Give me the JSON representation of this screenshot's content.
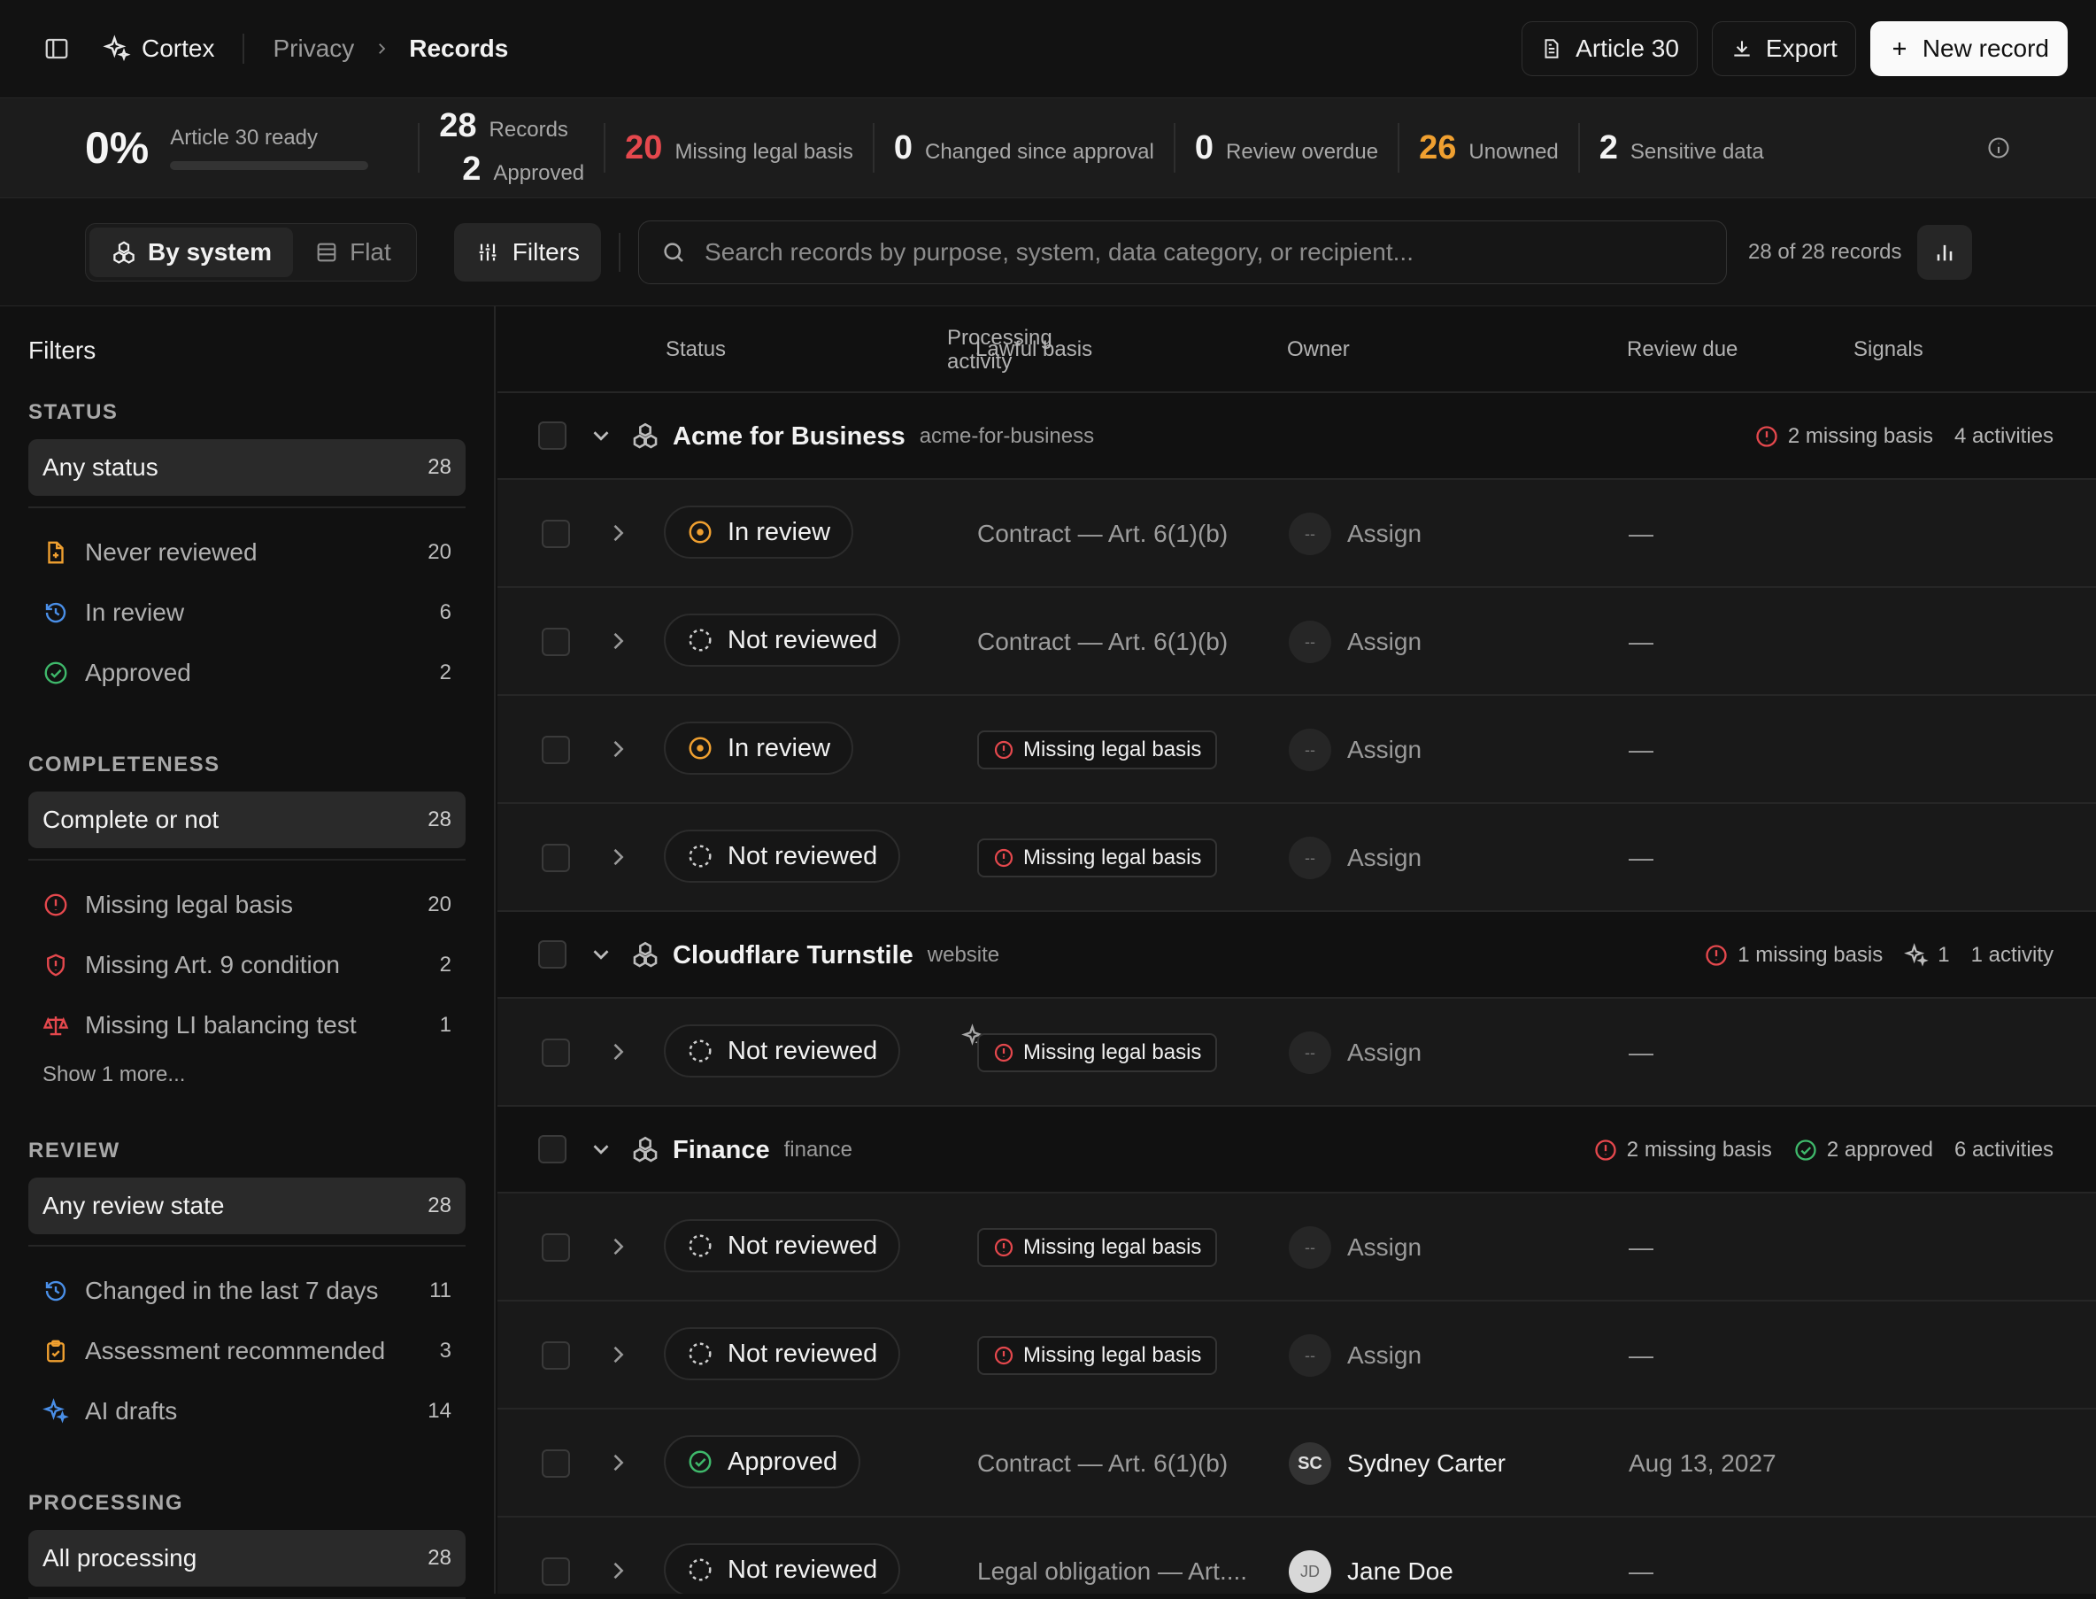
{
  "app": {
    "name": "Cortex",
    "breadcrumb": [
      "Privacy",
      "Records"
    ]
  },
  "header_buttons": {
    "article30": "Article 30",
    "export": "Export",
    "new_record": "New record"
  },
  "stats": {
    "percent": "0%",
    "percent_label": "Article 30 ready",
    "readiness_fraction": 0,
    "records": {
      "value": "28",
      "label": "Records"
    },
    "approved": {
      "value": "2",
      "label": "Approved"
    },
    "missing": {
      "value": "20",
      "label": "Missing legal basis"
    },
    "changed": {
      "value": "0",
      "label": "Changed since approval"
    },
    "overdue": {
      "value": "0",
      "label": "Review overdue"
    },
    "unowned": {
      "value": "26",
      "label": "Unowned"
    },
    "sensitive": {
      "value": "2",
      "label": "Sensitive data"
    }
  },
  "toolbar": {
    "view_by_system": "By system",
    "view_flat": "Flat",
    "filters": "Filters",
    "search_placeholder": "Search records by purpose, system, data category, or recipient...",
    "count": "28 of 28 records"
  },
  "sidebar": {
    "title": "Filters",
    "status": {
      "heading": "STATUS",
      "selected": {
        "label": "Any status",
        "count": "28"
      },
      "items": [
        {
          "label": "Never reviewed",
          "count": "20"
        },
        {
          "label": "In review",
          "count": "6"
        },
        {
          "label": "Approved",
          "count": "2"
        }
      ]
    },
    "completeness": {
      "heading": "COMPLETENESS",
      "selected": {
        "label": "Complete or not",
        "count": "28"
      },
      "items": [
        {
          "label": "Missing legal basis",
          "count": "20"
        },
        {
          "label": "Missing Art. 9 condition",
          "count": "2"
        },
        {
          "label": "Missing LI balancing test",
          "count": "1"
        }
      ],
      "more": "Show 1 more..."
    },
    "review": {
      "heading": "REVIEW",
      "selected": {
        "label": "Any review state",
        "count": "28"
      },
      "items": [
        {
          "label": "Changed in the last 7 days",
          "count": "11"
        },
        {
          "label": "Assessment recommended",
          "count": "3"
        },
        {
          "label": "AI drafts",
          "count": "14"
        }
      ]
    },
    "processing": {
      "heading": "PROCESSING",
      "selected": {
        "label": "All processing",
        "count": "28"
      }
    }
  },
  "table": {
    "headers": {
      "status": "Status",
      "activity": "Processing activity",
      "lawful": "Lawful basis",
      "owner": "Owner",
      "due": "Review due",
      "signals": "Signals"
    }
  },
  "groups": [
    {
      "name": "Acme for Business",
      "slug": "acme-for-business",
      "missing": "2 missing basis",
      "activities": "4 activities"
    },
    {
      "name": "Cloudflare Turnstile",
      "slug": "website",
      "missing": "1 missing basis",
      "ai": "1",
      "activities": "1 activity"
    },
    {
      "name": "Finance",
      "slug": "finance",
      "missing": "2 missing basis",
      "approved": "2 approved",
      "activities": "6 activities"
    }
  ],
  "rows": [
    {
      "status": "In review",
      "lawful": "Contract — Art. 6(1)(b)",
      "owner": "Assign",
      "owner_initials": "--",
      "due": "—"
    },
    {
      "status": "Not reviewed",
      "lawful": "Contract — Art. 6(1)(b)",
      "owner": "Assign",
      "owner_initials": "--",
      "due": "—"
    },
    {
      "status": "In review",
      "lawful": "Missing legal basis",
      "owner": "Assign",
      "owner_initials": "--",
      "due": "—"
    },
    {
      "status": "Not reviewed",
      "lawful": "Missing legal basis",
      "owner": "Assign",
      "owner_initials": "--",
      "due": "—"
    },
    {
      "status": "Not reviewed",
      "lawful": "Missing legal basis",
      "owner": "Assign",
      "owner_initials": "--",
      "due": "—"
    },
    {
      "status": "Not reviewed",
      "lawful": "Missing legal basis",
      "owner": "Assign",
      "owner_initials": "--",
      "due": "—"
    },
    {
      "status": "Not reviewed",
      "lawful": "Missing legal basis",
      "owner": "Assign",
      "owner_initials": "--",
      "due": "—"
    },
    {
      "status": "Approved",
      "lawful": "Contract — Art. 6(1)(b)",
      "owner": "Sydney Carter",
      "owner_initials": "SC",
      "due": "Aug 13, 2027"
    },
    {
      "status": "Not reviewed",
      "lawful": "Legal obligation — Art....",
      "owner": "Jane Doe",
      "owner_initials": "JD",
      "due": "—"
    }
  ],
  "colors": {
    "orange": "#f0a030",
    "red": "#e5484d",
    "green": "#3fb96b",
    "blue": "#4a8fe8"
  }
}
